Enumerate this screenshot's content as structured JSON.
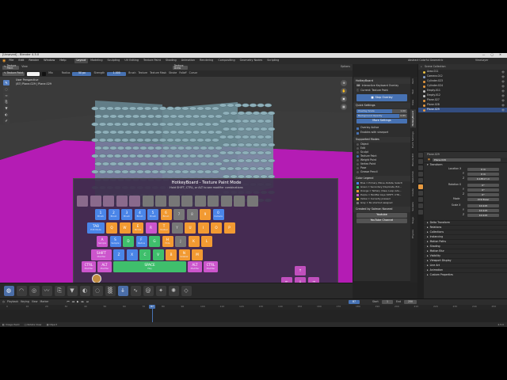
{
  "window_title": "[Unsaved] - Blender 4.5.0",
  "menu": [
    "File",
    "Edit",
    "Render",
    "Window",
    "Help"
  ],
  "workspaces": [
    "Layout",
    "Modeling",
    "Sculpting",
    "UV Editing",
    "Texture Paint",
    "Shading",
    "Animation",
    "Rendering",
    "Compositing",
    "Geometry Nodes",
    "Scripting"
  ],
  "active_workspace": "Layout",
  "scene_label": "Abstract Colorful Geometric",
  "view_layer": "ViewLayer",
  "editor_header": {
    "mode": "Texture Paint",
    "menus": [
      "View"
    ],
    "brush_name": "Texture Draw",
    "options": "Options"
  },
  "tool_settings": {
    "mix": "Mix",
    "radius_label": "Radius",
    "radius_value": "50 px",
    "strength_label": "Strength",
    "strength_value": "1.000",
    "brush": "Brush",
    "texture": "Texture",
    "texture_mask": "Texture Mask",
    "stroke": "Stroke",
    "falloff": "Falloff",
    "cursor": "Cursor"
  },
  "viewport_info": {
    "line1": "User Perspective",
    "line2": "(87) Plane.029 | Plane.029"
  },
  "hotkey_panel": {
    "title": "HotkeyBoard",
    "interactive_label": "Interactive Keyboard Overlay",
    "current_label": "Current: Texture Paint",
    "stop_button": "Stop Overlay",
    "quick_settings": "Quick Settings",
    "opacity_label": "Overlay Scale",
    "opacity_value": "1.00",
    "opacity_fill": 0.7,
    "bg_label": "Background Opacity",
    "bg_value": "0.85",
    "bg_fill": 0.85,
    "more_settings": "More Settings",
    "overlay_active": "Overlay Active",
    "enables_viewport": "Enables with viewport",
    "supported_modes": "Supported Modes",
    "modes": [
      "Object",
      "Edit",
      "Sculpt",
      "Texture Paint",
      "Weight Paint",
      "Vertex Paint",
      "Pose",
      "Grease Pencil"
    ],
    "active_mode": "Texture Paint",
    "color_legend": "Color Legend",
    "legend": [
      "Blue = Primary (Move, Rotate, Select)",
      "Green = Secondary (Duplicate, Ext...",
      "Orange = Tertiary (View, Loop cuts...",
      "Purple = Modifier keys (SHIFT, CTR...",
      "Yellow = Currently pressed",
      "Gray = No shortcut assigned"
    ],
    "created_by": "Created by Salman Naveed",
    "youtube": "Youtube",
    "channel": "YouTube Channel"
  },
  "sidebar_tabs": [
    "Item",
    "Tool",
    "View",
    "HotkeyBoard",
    "Paint Settings",
    "BlenderKit",
    "Sketchfab",
    "Create",
    "Sockets",
    "Stage",
    "Physics"
  ],
  "active_sidebar_tab": "HotkeyBoard",
  "outliner": {
    "title": "Scene Collection",
    "items": [
      {
        "name": "Area.011",
        "color": "#e8c040"
      },
      {
        "name": "Camera.012",
        "color": "#8aa0c8"
      },
      {
        "name": "Cylinder.023",
        "color": "#e89a40"
      },
      {
        "name": "Cylinder.024",
        "color": "#e89a40"
      },
      {
        "name": "Empty.011",
        "color": "#c8c8c8"
      },
      {
        "name": "Empty.012",
        "color": "#c8c8c8"
      },
      {
        "name": "Plane.027",
        "color": "#e89a40"
      },
      {
        "name": "Plane.028",
        "color": "#e89a40"
      },
      {
        "name": "Plane.029",
        "color": "#e89a40"
      }
    ],
    "selected": "Plane.029"
  },
  "properties": {
    "object_path": "Plane.029",
    "object_name": "Plane.029",
    "transform": "Transform",
    "location_label": "Location X",
    "location": [
      "0 m",
      "0 m",
      "0.18517 m"
    ],
    "rotation_label": "Rotation X",
    "rotation": [
      "0°",
      "0°",
      "0°"
    ],
    "mode_label": "Mode",
    "mode_value": "XYZ Euler",
    "scale_label": "Scale X",
    "scale": [
      "10.115",
      "10.115",
      "10.115"
    ],
    "sections": [
      "Delta Transform",
      "Relations",
      "Collections",
      "Instancing",
      "Motion Paths",
      "Shading",
      "Motion Blur",
      "Visibility",
      "Viewport Display",
      "Line Art",
      "Animation",
      "Custom Properties"
    ]
  },
  "overlay": {
    "title": "HotkeyBoard - Texture Paint Mode",
    "subtitle": "Hold SHIFT, CTRL, or ALT to see modifier combinations",
    "keys": [
      {
        "row": 0,
        "label": "",
        "sub": "",
        "color": "dim"
      },
      {
        "row": 0,
        "label": "",
        "sub": "",
        "color": "dim"
      },
      {
        "row": 0,
        "label": "",
        "sub": "",
        "color": "dim"
      },
      {
        "row": 0,
        "label": "",
        "sub": "",
        "color": "dim"
      },
      {
        "row": 0,
        "label": "",
        "sub": "",
        "color": "dim"
      },
      {
        "row": 0,
        "label": "",
        "sub": "",
        "color": "gray"
      },
      {
        "row": 0,
        "label": "",
        "sub": "",
        "color": "gray"
      },
      {
        "row": 0,
        "label": "",
        "sub": "",
        "color": "gray"
      },
      {
        "row": 0,
        "label": "",
        "sub": "",
        "color": "gray"
      },
      {
        "row": 0,
        "label": "",
        "sub": "",
        "color": "gray"
      },
      {
        "row": 0,
        "label": "",
        "sub": "",
        "color": "gray"
      },
      {
        "row": 0,
        "label": "",
        "sub": "",
        "color": "gray"
      },
      {
        "row": 0,
        "label": "",
        "sub": "",
        "color": "gray"
      },
      {
        "row": 0,
        "label": "",
        "sub": "",
        "color": "gray"
      },
      {
        "row": 1,
        "label": "1",
        "sub": "Brush",
        "color": "blue"
      },
      {
        "row": 1,
        "label": "2",
        "sub": "Brush",
        "color": "blue"
      },
      {
        "row": 1,
        "label": "3",
        "sub": "Brush",
        "color": "blue"
      },
      {
        "row": 1,
        "label": "4",
        "sub": "Brush",
        "color": "blue"
      },
      {
        "row": 1,
        "label": "5",
        "sub": "Brush",
        "color": "blue"
      },
      {
        "row": 1,
        "label": "6",
        "sub": "Brush",
        "color": "orange"
      },
      {
        "row": 1,
        "label": "7",
        "sub": "",
        "color": "gray"
      },
      {
        "row": 1,
        "label": "8",
        "sub": "",
        "color": "gray"
      },
      {
        "row": 1,
        "label": "9",
        "sub": "",
        "color": "orange"
      },
      {
        "row": 1,
        "label": "0",
        "sub": "Camera",
        "color": "blue"
      },
      {
        "row": 2,
        "label": "TAB",
        "sub": "Edit Mode",
        "color": "blue"
      },
      {
        "row": 2,
        "label": "Q",
        "sub": "",
        "color": "orange"
      },
      {
        "row": 2,
        "label": "W",
        "sub": "",
        "color": "orange"
      },
      {
        "row": 2,
        "label": "E",
        "sub": "Stroke",
        "color": "orange"
      },
      {
        "row": 2,
        "label": "R",
        "sub": "",
        "color": "pink"
      },
      {
        "row": 2,
        "label": "T",
        "sub": "Toolbar",
        "color": "orange"
      },
      {
        "row": 2,
        "label": "Y",
        "sub": "",
        "color": "gray"
      },
      {
        "row": 2,
        "label": "U",
        "sub": "",
        "color": "orange"
      },
      {
        "row": 2,
        "label": "I",
        "sub": "",
        "color": "orange"
      },
      {
        "row": 2,
        "label": "O",
        "sub": "",
        "color": "orange"
      },
      {
        "row": 2,
        "label": "P",
        "sub": "",
        "color": "orange"
      },
      {
        "row": 3,
        "label": "A",
        "sub": "Sample",
        "color": "pink"
      },
      {
        "row": 3,
        "label": "S",
        "sub": "Sample",
        "color": "blue"
      },
      {
        "row": 3,
        "label": "D",
        "sub": "",
        "color": "green"
      },
      {
        "row": 3,
        "label": "F",
        "sub": "Radius",
        "color": "blue"
      },
      {
        "row": 3,
        "label": "G",
        "sub": "",
        "color": "green"
      },
      {
        "row": 3,
        "label": "H",
        "sub": "Hide",
        "color": "orange"
      },
      {
        "row": 3,
        "label": "J",
        "sub": "",
        "color": "gray"
      },
      {
        "row": 3,
        "label": "K",
        "sub": "",
        "color": "orange"
      },
      {
        "row": 3,
        "label": "L",
        "sub": "",
        "color": "orange"
      },
      {
        "row": 4,
        "label": "SHIFT",
        "sub": "Modifier",
        "color": "pink"
      },
      {
        "row": 4,
        "label": "Z",
        "sub": "",
        "color": "blue"
      },
      {
        "row": 4,
        "label": "X",
        "sub": "",
        "color": "blue"
      },
      {
        "row": 4,
        "label": "C",
        "sub": "",
        "color": "green"
      },
      {
        "row": 4,
        "label": "V",
        "sub": "",
        "color": "green"
      },
      {
        "row": 4,
        "label": "B",
        "sub": "",
        "color": "orange"
      },
      {
        "row": 4,
        "label": "N",
        "sub": "Sidebar",
        "color": "orange"
      },
      {
        "row": 4,
        "label": "M",
        "sub": "",
        "color": "orange"
      },
      {
        "row": 5,
        "label": "CTRL",
        "sub": "Modifier",
        "color": "pink"
      },
      {
        "row": 5,
        "label": "ALT",
        "sub": "Modifier",
        "color": "pink"
      },
      {
        "row": 5,
        "label": "SPACE",
        "sub": "Play",
        "color": "green"
      },
      {
        "row": 5,
        "label": "ALT",
        "sub": "Modifier",
        "color": "pink"
      },
      {
        "row": 5,
        "label": "CTRL",
        "sub": "Modifier",
        "color": "pink"
      }
    ],
    "arrows": [
      "↑",
      "←",
      "↓",
      "→"
    ]
  },
  "timeline": {
    "menus": [
      "Playback",
      "Keying",
      "View",
      "Marker"
    ],
    "current_frame": "87",
    "ticks": [
      "0",
      "10",
      "20",
      "30",
      "40",
      "50",
      "60",
      "70",
      "80",
      "90",
      "100",
      "110",
      "120",
      "130",
      "140",
      "150",
      "160",
      "170",
      "180",
      "190",
      "200",
      "210",
      "220",
      "230",
      "240",
      "250"
    ],
    "start_label": "Start",
    "start": "1",
    "end_label": "End",
    "end": "250"
  },
  "status": {
    "left": "Image Paint",
    "mid": "Rotate View",
    "right": "Object",
    "version": "4.5.0"
  },
  "colors": {
    "accent": "#4772b3",
    "ground": "#b41cb4",
    "key_pink": "#cc55cc",
    "key_blue": "#4a85e8",
    "key_orange": "#f29a32",
    "key_green": "#3fbf6c"
  }
}
